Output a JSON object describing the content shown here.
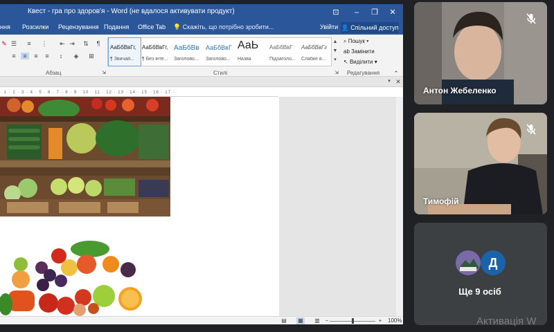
{
  "word": {
    "title": "Квест - гра про здоров'я - Word (не вдалося активувати продукт)",
    "tabs": [
      "ння",
      "Розсилки",
      "Рецензування",
      "Подання",
      "Office Tab"
    ],
    "tell_me": "Скажіть, що потрібно зробити...",
    "sign_in": "Увійти",
    "share": "Спільний доступ",
    "groups": {
      "paragraph": "Абзац",
      "styles": "Стилі",
      "editing": "Редагування"
    },
    "styles": [
      {
        "preview": "АаБбВвГг,",
        "name": "¶ Звичай..."
      },
      {
        "preview": "АаБбВвГг,",
        "name": "¶ Без інте..."
      },
      {
        "preview": "АаБбВв",
        "name": "Заголово..."
      },
      {
        "preview": "АаБбВвГ",
        "name": "Заголово..."
      },
      {
        "preview": "АаЬ",
        "name": "Назва"
      },
      {
        "preview": "АаБбВвГ",
        "name": "Підзаголо..."
      },
      {
        "preview": "АаБбВвГг",
        "name": "Слабке в..."
      }
    ],
    "editing": {
      "find": "Пошук",
      "replace": "Замінити",
      "select": "Виділити"
    },
    "ruler_text": "· 1 · 2 · 3 · 4 · 5 · 6 · 7 · 8 · 9 · 10 · 11 · 12 · 13 · 14 · 15 · 16 · 17 ·",
    "zoom": "100%"
  },
  "meet": {
    "participants": [
      {
        "name": "Антон Жебеленко",
        "muted": true
      },
      {
        "name": "Тимофій",
        "muted": true
      }
    ],
    "others": {
      "avatar_letter": "Д",
      "label": "Ще 9 осіб"
    }
  },
  "watermark": "Активація W",
  "colors": {
    "word_blue": "#2b579a",
    "meet_bg": "#202124",
    "tile_gray": "#3c4043",
    "avatar_blue": "#1a63a8"
  }
}
